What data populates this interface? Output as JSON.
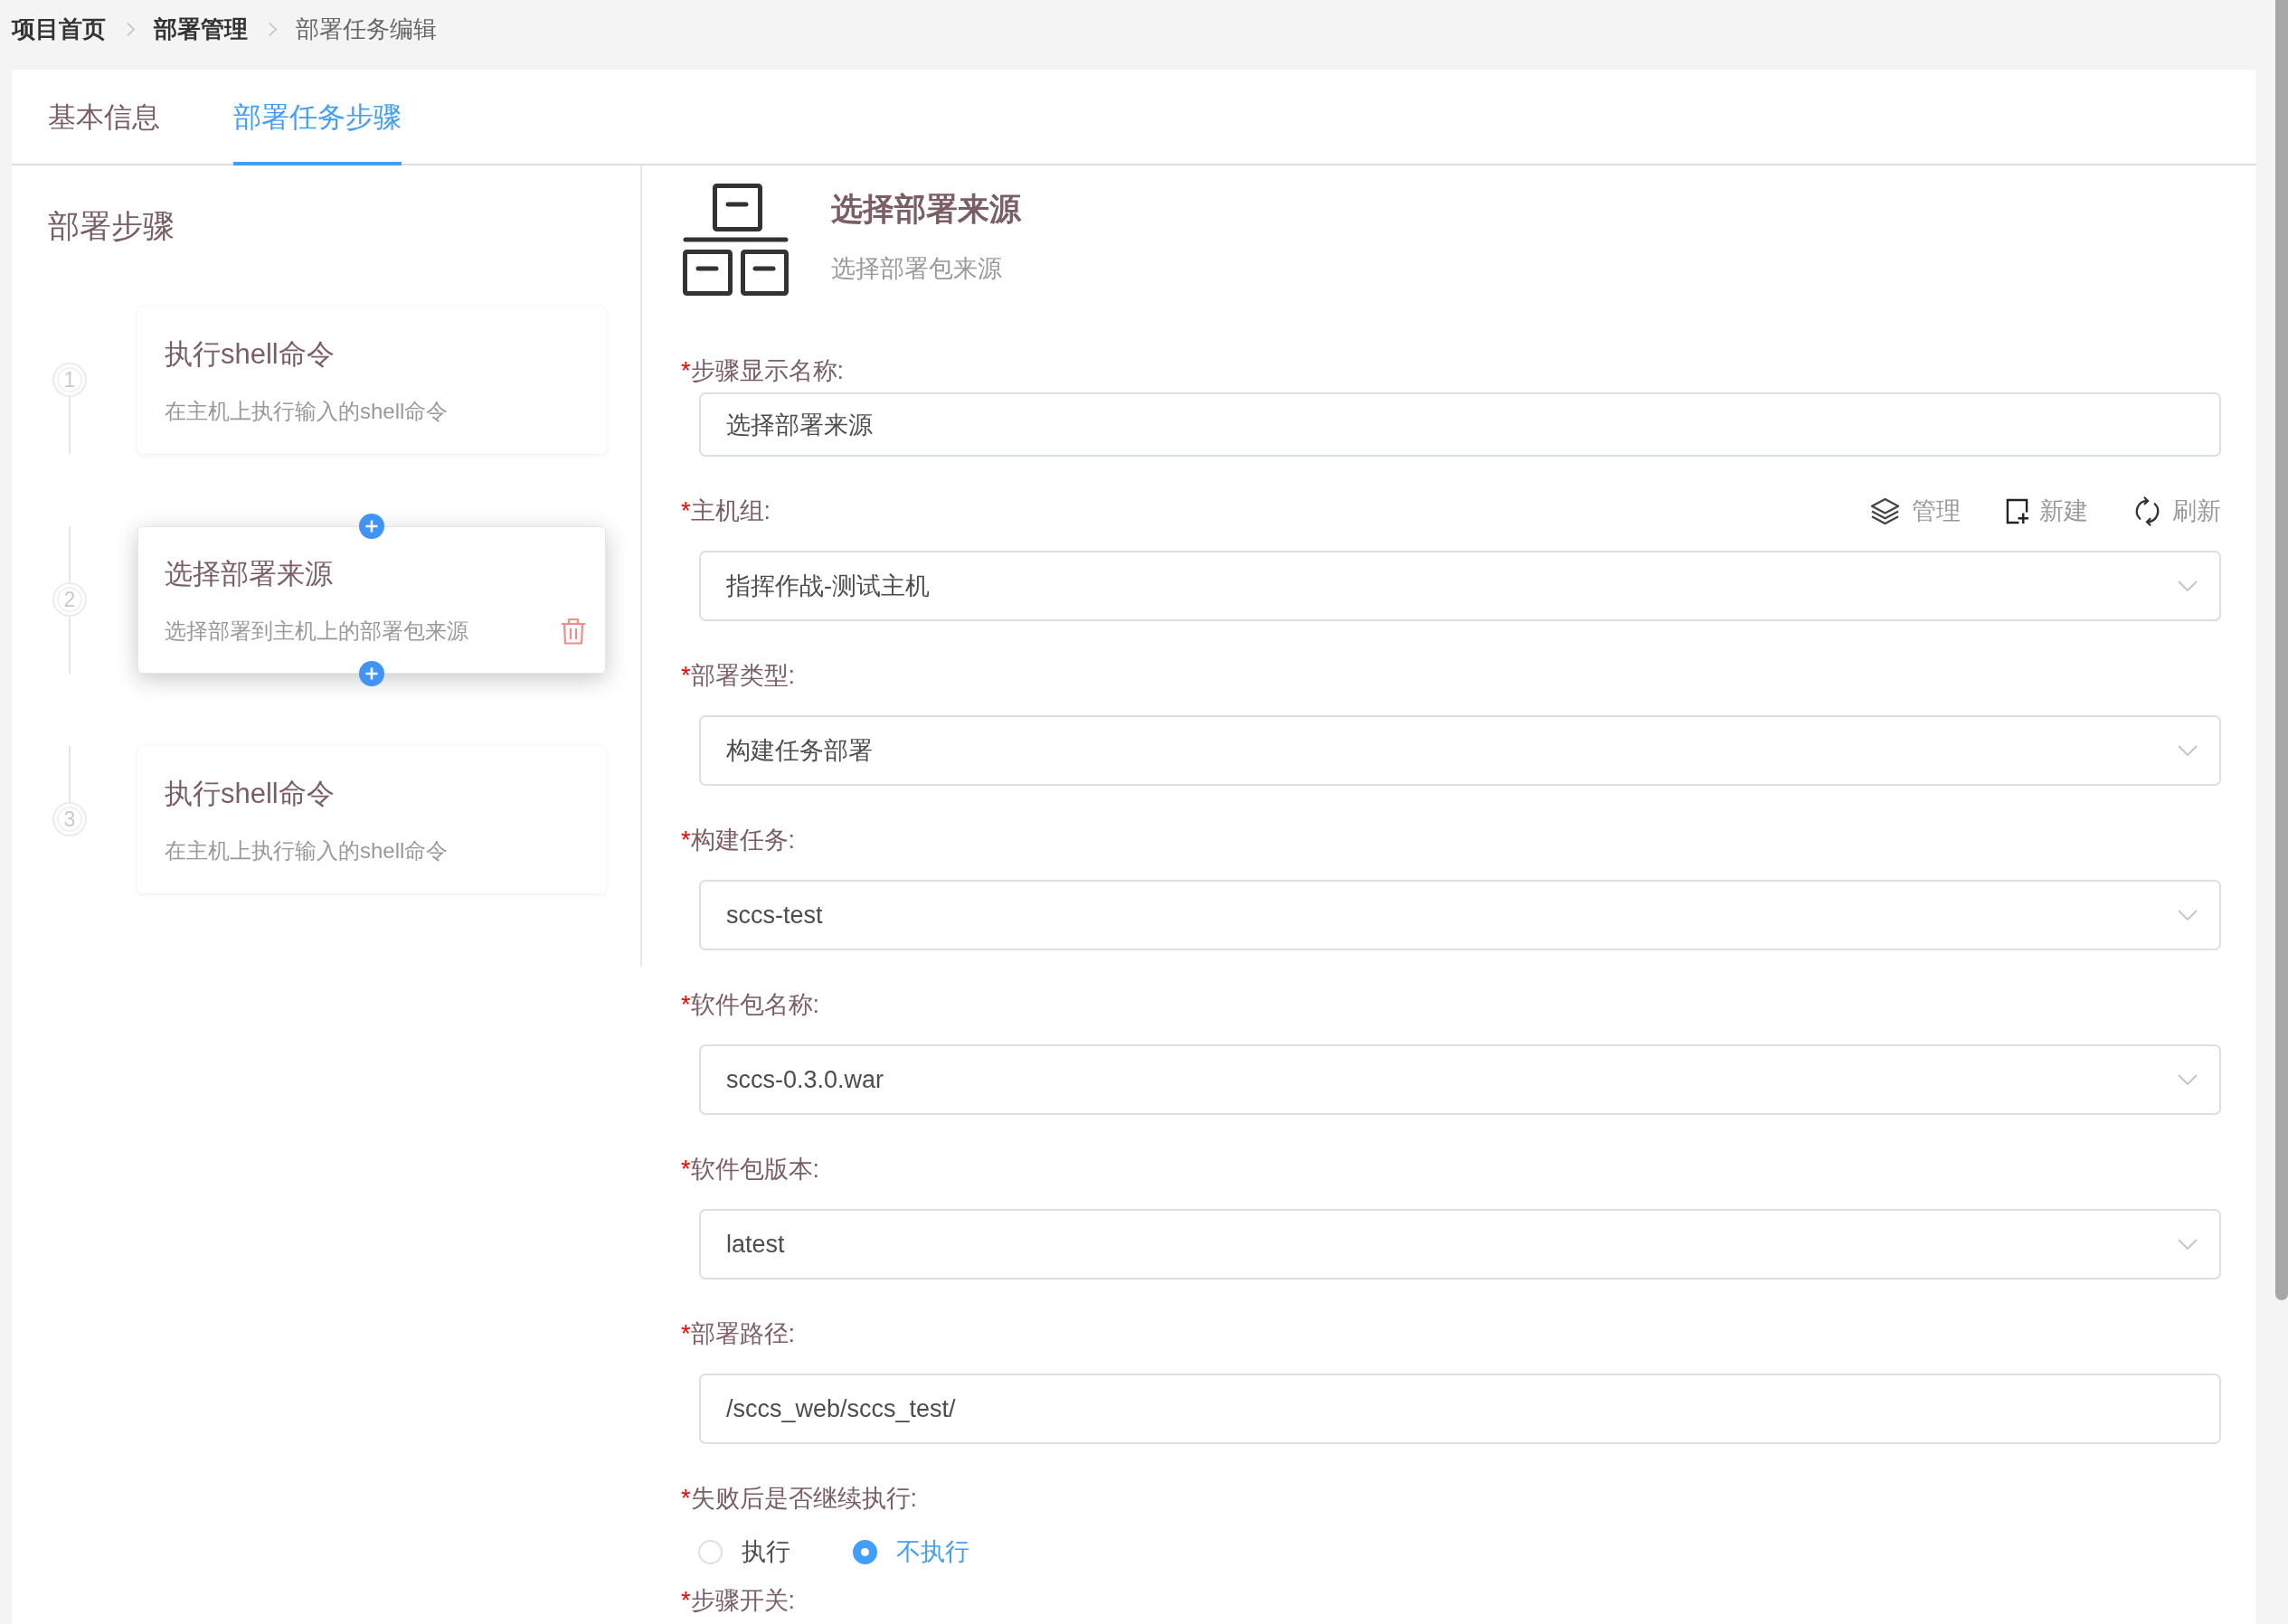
{
  "breadcrumb": [
    {
      "label": "项目首页",
      "kind": "link"
    },
    {
      "label": "部署管理",
      "kind": "link"
    },
    {
      "label": "部署任务编辑",
      "kind": "current"
    }
  ],
  "tabs": [
    {
      "label": "基本信息",
      "selected": false
    },
    {
      "label": "部署任务步骤",
      "selected": true
    }
  ],
  "steps_panel": {
    "title": "部署步骤",
    "steps": [
      {
        "number": "1",
        "title": "执行shell命令",
        "description": "在主机上执行输入的shell命令",
        "selected": false
      },
      {
        "number": "2",
        "title": "选择部署来源",
        "description": "选择部署到主机上的部署包来源",
        "selected": true
      },
      {
        "number": "3",
        "title": "执行shell命令",
        "description": "在主机上执行输入的shell命令",
        "selected": false
      }
    ]
  },
  "step_detail": {
    "title": "选择部署来源",
    "subtitle": "选择部署包来源",
    "fields": [
      {
        "kind": "text",
        "required_mark": "*",
        "label": "步骤显示名称:",
        "value": "选择部署来源"
      },
      {
        "kind": "select",
        "required_mark": "*",
        "label": "主机组:",
        "value": "指挥作战-测试主机",
        "actions": [
          {
            "label": "管理"
          },
          {
            "label": "新建"
          },
          {
            "label": "刷新"
          }
        ]
      },
      {
        "kind": "select",
        "required_mark": "*",
        "label": "部署类型:",
        "value": "构建任务部署"
      },
      {
        "kind": "select",
        "required_mark": "*",
        "label": "构建任务:",
        "value": "sccs-test"
      },
      {
        "kind": "select",
        "required_mark": "*",
        "label": "软件包名称:",
        "value": "sccs-0.3.0.war"
      },
      {
        "kind": "select",
        "required_mark": "*",
        "label": "软件包版本:",
        "value": "latest"
      },
      {
        "kind": "text",
        "required_mark": "*",
        "label": "部署路径:",
        "value": "/sccs_web/sccs_test/"
      },
      {
        "kind": "radio",
        "required_mark": "*",
        "label": "失败后是否继续执行:",
        "options": [
          {
            "label": "执行",
            "selected": false
          },
          {
            "label": "不执行",
            "selected": true
          }
        ]
      },
      {
        "kind": "switch",
        "required_mark": "*",
        "label": "步骤开关:"
      }
    ]
  }
}
